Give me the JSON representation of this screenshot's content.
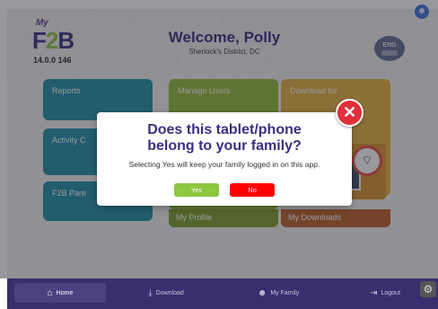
{
  "header": {
    "logo_prefix": "My",
    "logo_main_a": "F",
    "logo_main_b": "2",
    "logo_main_c": "B",
    "version": "14.0.0 146",
    "welcome_title": "Welcome, Polly",
    "welcome_subtitle": "Sherlock's District, DC",
    "language_code": "ENG"
  },
  "tiles": {
    "reports": "Reports",
    "activity": "Activity C",
    "parent": "F2B Pare",
    "manage_users": "Manage Users",
    "my_profile": "My Profile",
    "download_for": "Download for",
    "my_downloads": "My Downloads"
  },
  "dialog": {
    "title_line1": "Does this tablet/phone",
    "title_line2": "belong to your family?",
    "message": "Selecting Yes will keep your family logged in on this app.",
    "yes_label": "Yes",
    "no_label": "No",
    "close_symbol": "✕"
  },
  "bottom_nav": {
    "items": [
      {
        "label": "Home",
        "icon": "home-icon",
        "active": true
      },
      {
        "label": "Download",
        "icon": "download-icon",
        "active": false
      },
      {
        "label": "My Family",
        "icon": "family-icon",
        "active": false
      },
      {
        "label": "Logout",
        "icon": "logout-icon",
        "active": false
      }
    ]
  },
  "colors": {
    "brand_purple": "#3b2f82",
    "tile_teal": "#1d8ea6",
    "tile_green": "#8fbc32",
    "tile_orange": "#e6b13a",
    "yes_green": "#8dc63f",
    "no_red": "#ff0000",
    "close_red": "#e1303a",
    "nav_bg": "#3a2e6e"
  }
}
